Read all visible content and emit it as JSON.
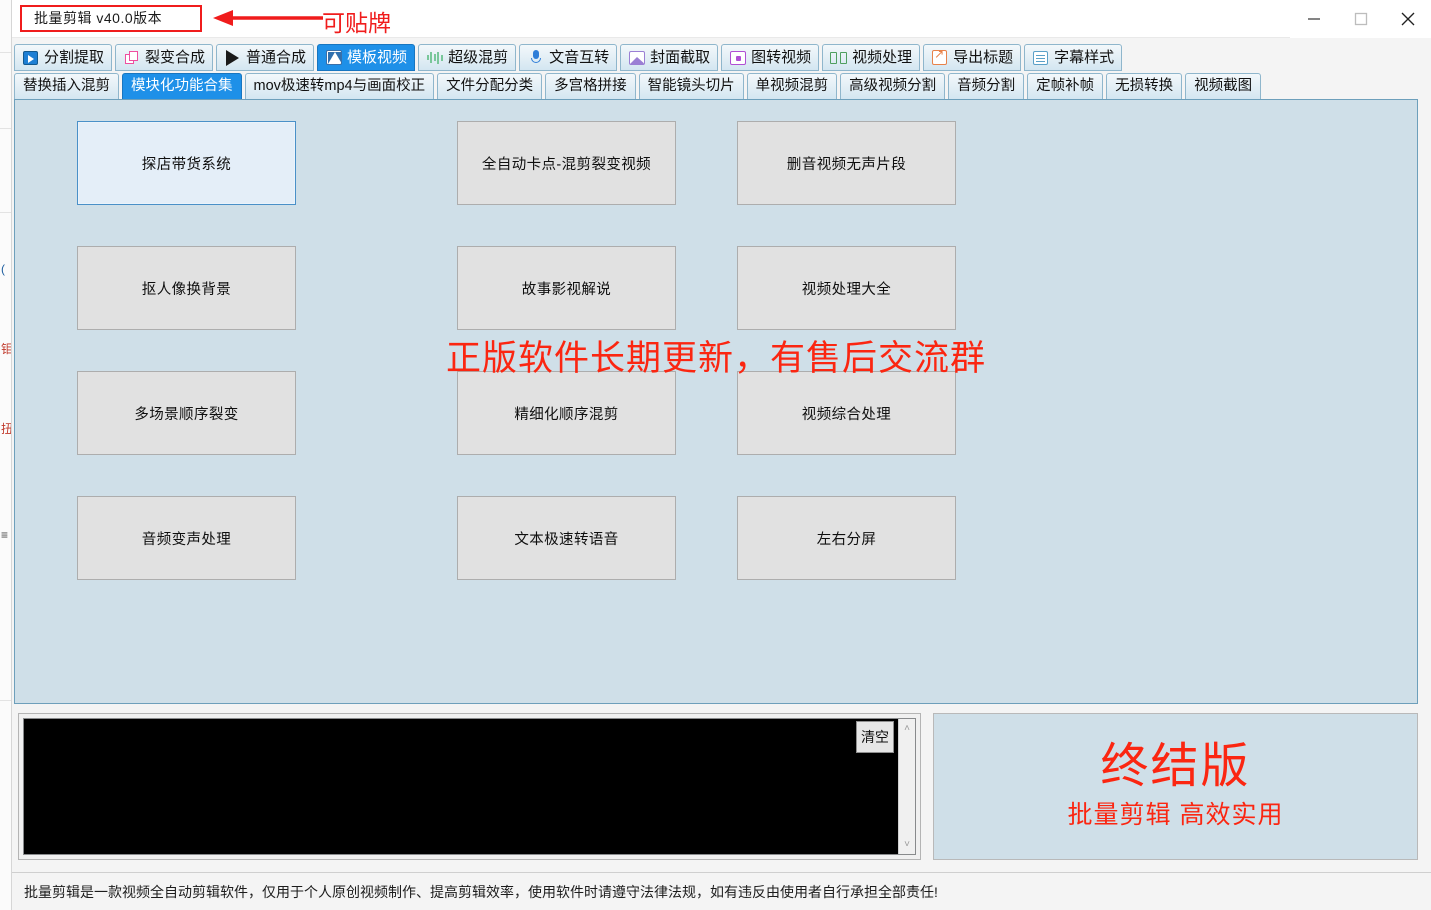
{
  "window": {
    "title": "批量剪辑  v40.0版本",
    "controls": {
      "minimize": "minimize-button",
      "maximize": "maximize-button",
      "close": "close-button"
    }
  },
  "annotation": {
    "label": "可贴牌",
    "color": "#f01c1c"
  },
  "tabs_primary": [
    {
      "label": "分割提取",
      "icon": "film-play-icon",
      "active": false
    },
    {
      "label": "裂变合成",
      "icon": "copy-icon",
      "active": false
    },
    {
      "label": "普通合成",
      "icon": "play-icon",
      "active": false
    },
    {
      "label": "模板视频",
      "icon": "template-icon",
      "active": true
    },
    {
      "label": "超级混剪",
      "icon": "waveform-icon",
      "active": false
    },
    {
      "label": "文音互转",
      "icon": "microphone-icon",
      "active": false
    },
    {
      "label": "封面截取",
      "icon": "picture-icon",
      "active": false
    },
    {
      "label": "图转视频",
      "icon": "image-to-video-icon",
      "active": false
    },
    {
      "label": "视频处理",
      "icon": "video-process-icon",
      "active": false
    },
    {
      "label": "导出标题",
      "icon": "export-icon",
      "active": false
    },
    {
      "label": "字幕样式",
      "icon": "subtitle-icon",
      "active": false
    }
  ],
  "tabs_secondary": [
    {
      "label": "替换插入混剪",
      "active": false
    },
    {
      "label": "模块化功能合集",
      "active": true
    },
    {
      "label": "mov极速转mp4与画面校正",
      "active": false
    },
    {
      "label": "文件分配分类",
      "active": false
    },
    {
      "label": "多宫格拼接",
      "active": false
    },
    {
      "label": "智能镜头切片",
      "active": false
    },
    {
      "label": "单视频混剪",
      "active": false
    },
    {
      "label": "高级视频分割",
      "active": false
    },
    {
      "label": "音频分割",
      "active": false
    },
    {
      "label": "定帧补帧",
      "active": false
    },
    {
      "label": "无损转换",
      "active": false
    },
    {
      "label": "视频截图",
      "active": false
    }
  ],
  "module_buttons": [
    {
      "label": "探店带货系统",
      "selected": true
    },
    {
      "label": "全自动卡点-混剪裂变视频",
      "selected": false
    },
    {
      "label": "删音视频无声片段",
      "selected": false
    },
    {
      "label": "抠人像换背景",
      "selected": false
    },
    {
      "label": "故事影视解说",
      "selected": false
    },
    {
      "label": "视频处理大全",
      "selected": false
    },
    {
      "label": "多场景顺序裂变",
      "selected": false
    },
    {
      "label": "精细化顺序混剪",
      "selected": false
    },
    {
      "label": "视频综合处理",
      "selected": false
    },
    {
      "label": "音频变声处理",
      "selected": false
    },
    {
      "label": "文本极速转语音",
      "selected": false
    },
    {
      "label": "左右分屏",
      "selected": false
    }
  ],
  "watermark": {
    "text": "正版软件长期更新，有售后交流群",
    "color": "#fb2611"
  },
  "log_panel": {
    "content": "",
    "clear_button": "清空",
    "scroll_up": "˄",
    "scroll_down": "˅"
  },
  "promo": {
    "headline": "终结版",
    "subline": "批量剪辑 高效实用",
    "color": "#fb2611"
  },
  "status_bar": {
    "text": "批量剪辑是一款视频全自动剪辑软件，仅用于个人原创视频制作、提高剪辑效率，使用软件时请遵守法律法规，如有违反由使用者自行承担全部责任!"
  },
  "background_window_fragments": [
    "(",
    "钼",
    "扭",
    "≡"
  ]
}
